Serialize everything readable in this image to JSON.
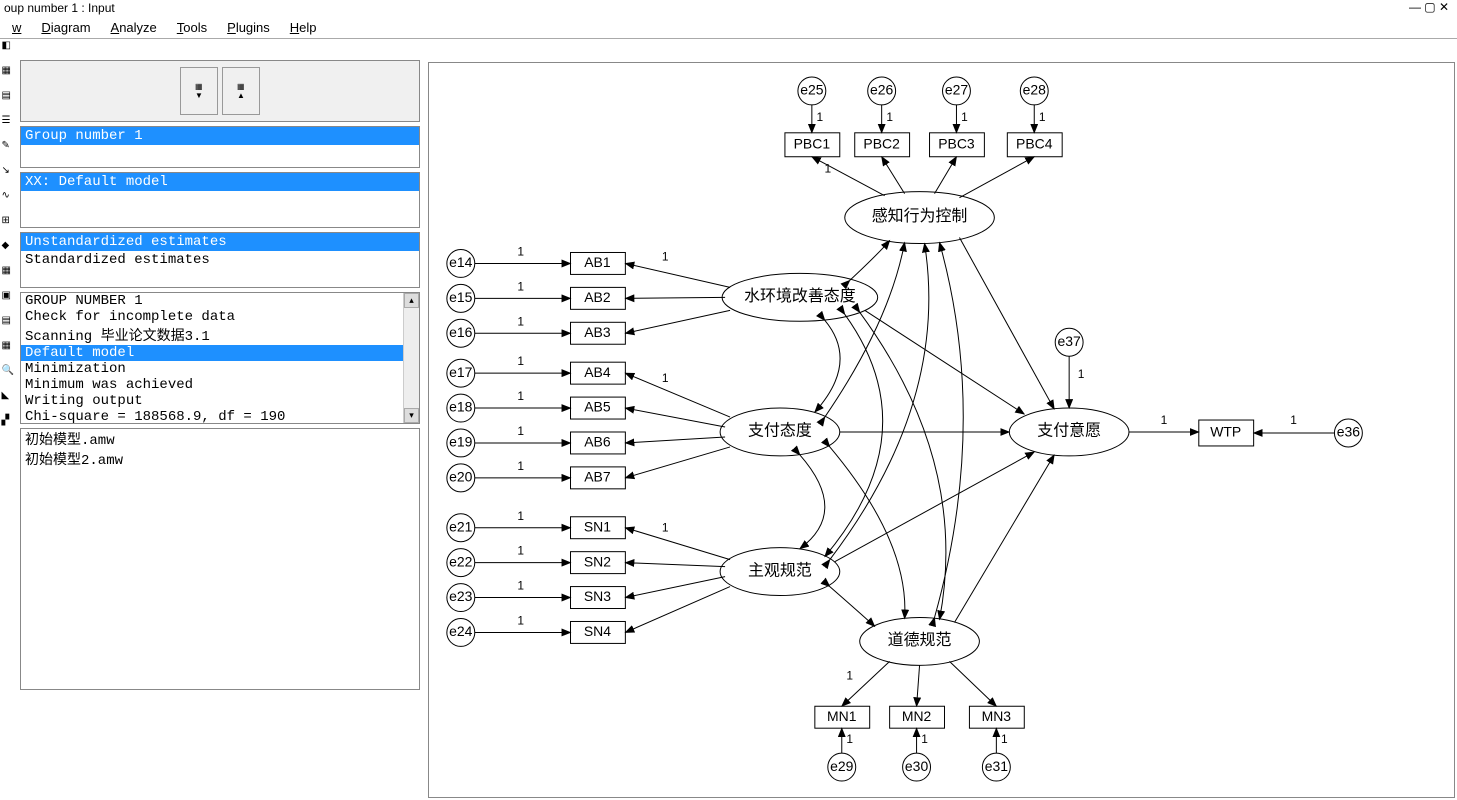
{
  "window": {
    "title_fragment": "oup number 1 : Input"
  },
  "menu": {
    "items": [
      "w",
      "Diagram",
      "Analyze",
      "Tools",
      "Plugins",
      "Help"
    ]
  },
  "groups_panel": {
    "selected": "Group number 1"
  },
  "models_panel": {
    "selected": "XX: Default model"
  },
  "estimates_panel": {
    "lines": [
      "Unstandardized estimates",
      "Standardized estimates"
    ],
    "selected_index": 0
  },
  "output_panel": {
    "lines": [
      "GROUP NUMBER 1",
      "Check for incomplete data",
      "Scanning 毕业论文数据3.1",
      "Default model",
      "Minimization",
      "Minimum was achieved",
      "Writing output",
      "Chi-square = 188568.9, df = 190"
    ],
    "selected_index": 3
  },
  "files_panel": {
    "lines": [
      "初始模型.amw",
      "初始模型2.amw"
    ]
  },
  "diagram": {
    "latents": {
      "pbc": {
        "label": "感知行为控制"
      },
      "attw": {
        "label": "水环境改善态度"
      },
      "attp": {
        "label": "支付态度"
      },
      "sn": {
        "label": "主观规范"
      },
      "mn": {
        "label": "道德规范"
      },
      "int": {
        "label": "支付意愿"
      }
    },
    "observed": {
      "PBC1": "PBC1",
      "PBC2": "PBC2",
      "PBC3": "PBC3",
      "PBC4": "PBC4",
      "AB1": "AB1",
      "AB2": "AB2",
      "AB3": "AB3",
      "AB4": "AB4",
      "AB5": "AB5",
      "AB6": "AB6",
      "AB7": "AB7",
      "SN1": "SN1",
      "SN2": "SN2",
      "SN3": "SN3",
      "SN4": "SN4",
      "MN1": "MN1",
      "MN2": "MN2",
      "MN3": "MN3",
      "WTP": "WTP"
    },
    "errors": {
      "e14": "e14",
      "e15": "e15",
      "e16": "e16",
      "e17": "e17",
      "e18": "e18",
      "e19": "e19",
      "e20": "e20",
      "e21": "e21",
      "e22": "e22",
      "e23": "e23",
      "e24": "e24",
      "e25": "e25",
      "e26": "e26",
      "e27": "e27",
      "e28": "e28",
      "e29": "e29",
      "e30": "e30",
      "e31": "e31",
      "e36": "e36",
      "e37": "e37"
    },
    "fixed_weight": "1"
  }
}
